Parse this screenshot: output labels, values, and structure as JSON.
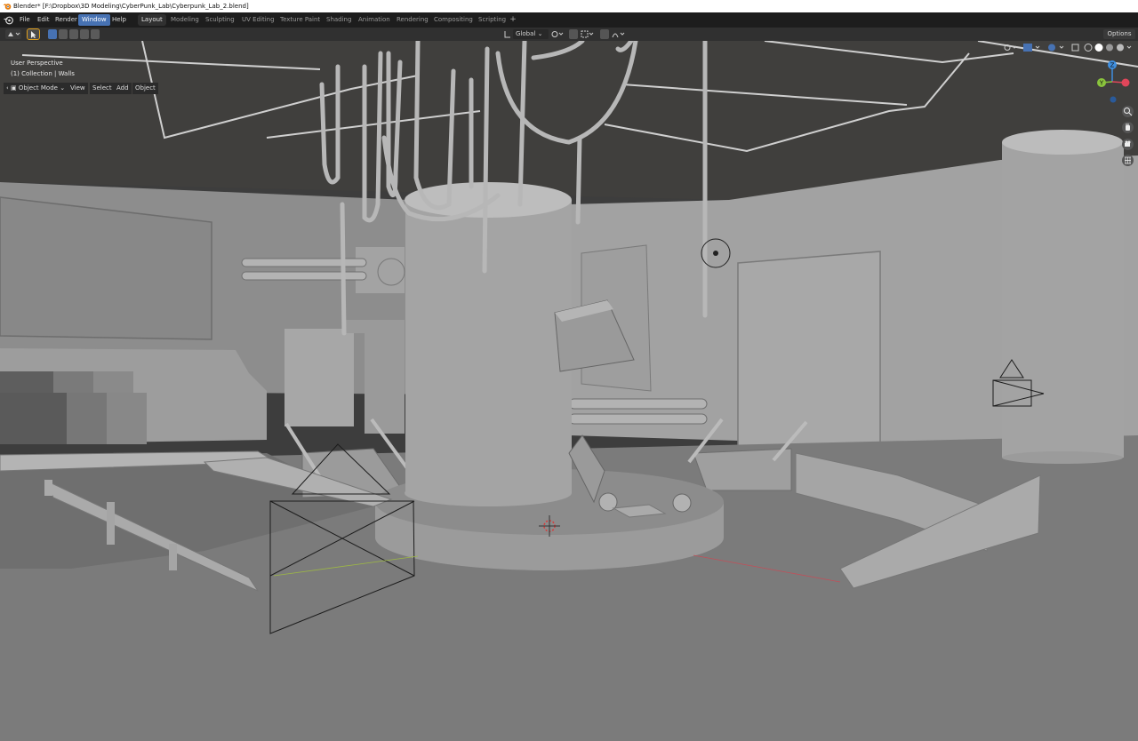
{
  "window": {
    "title": "Blender* [F:\\Dropbox\\3D Modeling\\CyberPunk_Lab\\Cyberpunk_Lab_2.blend]"
  },
  "menus": [
    "File",
    "Edit",
    "Render",
    "Window",
    "Help"
  ],
  "active_menu": "Window",
  "workspaces": [
    "Layout",
    "Modeling",
    "Sculpting",
    "UV Editing",
    "Texture Paint",
    "Shading",
    "Animation",
    "Rendering",
    "Compositing",
    "Scripting"
  ],
  "active_workspace": "Layout",
  "toolbar": {
    "transform_orientation": "Global",
    "options_label": "Options"
  },
  "viewport_header": {
    "mode": "Object Mode",
    "items": [
      "View",
      "Select",
      "Add",
      "Object"
    ]
  },
  "overlay": {
    "perspective": "User Perspective",
    "collection": "(1) Collection | Walls"
  },
  "gizmo": {
    "z_label": "Z",
    "y_label": "Y"
  },
  "colors": {
    "accent": "#4772b3",
    "axis_x": "#e0465a",
    "axis_y": "#8ac43d",
    "axis_z": "#3f8fe0"
  }
}
